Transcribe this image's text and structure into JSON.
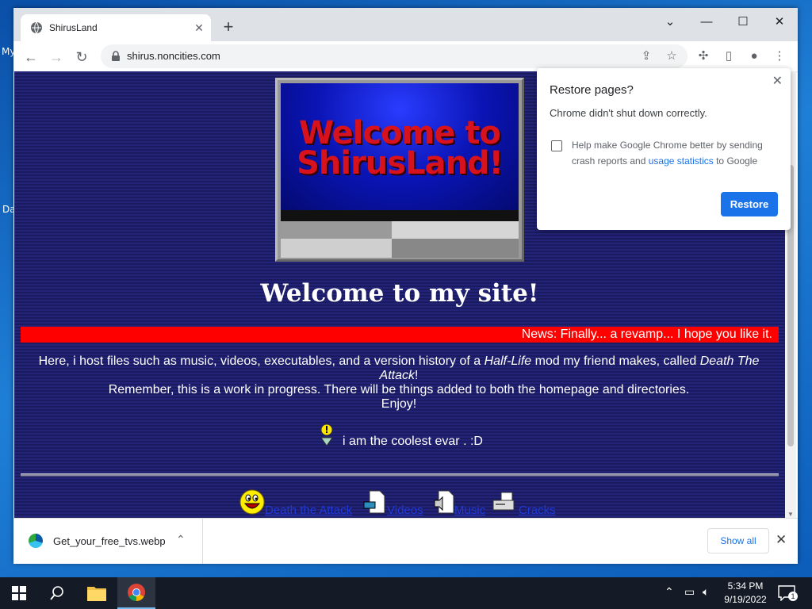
{
  "desktop": {
    "label_1": "My",
    "label_2": "Da"
  },
  "browser": {
    "tab": {
      "title": "ShirusLand"
    },
    "address": {
      "url": "shirus.noncities.com"
    }
  },
  "page": {
    "banner_text": "Welcome to ShirusLand!",
    "heading": "Welcome to my site!",
    "news": "News: Finally... a revamp... I hope you like it.",
    "intro_line1_a": "Here, i host files such as music, videos, executables, and a version history of a ",
    "intro_line1_hl": "Half-Life",
    "intro_line1_b": " mod my friend makes, called ",
    "intro_line1_dta": "Death The Attack",
    "intro_line1_c": "!",
    "intro_line2": "Remember, this is a work in progress. There will be things added to both the homepage and directories.",
    "intro_line3": "Enjoy!",
    "cool_text": "i am the coolest evar . :D",
    "nav": [
      {
        "label": "Death the Attack",
        "icon": "smiley-icon"
      },
      {
        "label": "Videos",
        "icon": "video-file-icon"
      },
      {
        "label": "Music",
        "icon": "music-file-icon"
      },
      {
        "label": "Cracks",
        "icon": "disk-drive-icon"
      }
    ]
  },
  "popup": {
    "title": "Restore pages?",
    "message": "Chrome didn't shut down correctly.",
    "checkbox_text_a": "Help make Google Chrome better by sending crash reports and ",
    "checkbox_link": "usage statistics",
    "checkbox_text_b": " to Google",
    "checkbox_checked": false,
    "restore_label": "Restore"
  },
  "downloads": {
    "file_name": "Get_your_free_tvs.webp",
    "show_all_label": "Show all"
  },
  "taskbar": {
    "time": "5:34 PM",
    "date": "9/19/2022",
    "notification_count": "1"
  },
  "colors": {
    "page_bg": "#1a1a5e",
    "news_bar": "#ff0000",
    "link": "#1e3ad8",
    "chrome_blue": "#1a73e8"
  }
}
